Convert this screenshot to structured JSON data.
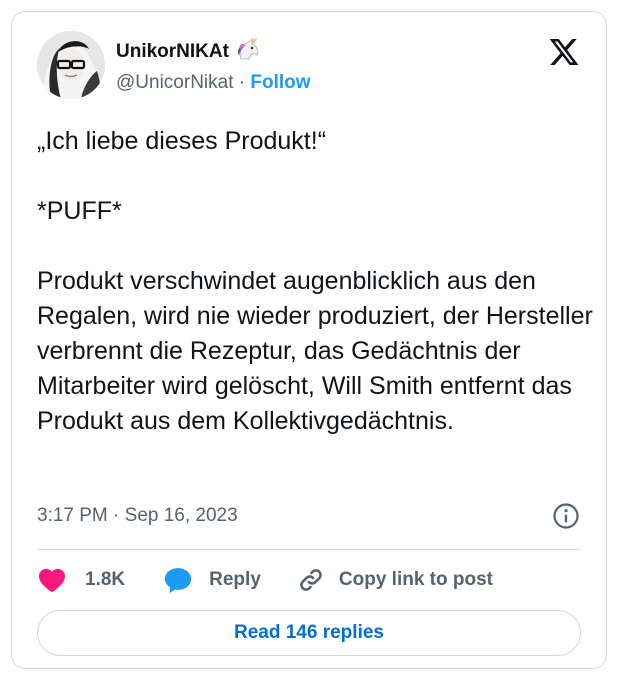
{
  "author": {
    "display_name": "UnikorNIKAt",
    "name_emoji_icon": "unicorn-icon",
    "handle": "@UnicorNikat",
    "separator": "·",
    "follow_label": "Follow"
  },
  "brand_icon": "x-logo-icon",
  "tweet": {
    "text": "„Ich liebe dieses Produkt!“\n\n*PUFF*\n\nProdukt verschwindet augenblicklich aus den Regalen, wird nie wieder produziert, der Hersteller verbrennt die Rezeptur, das Gedächtnis der Mitarbeiter wird gelöscht, Will Smith entfernt das Produkt aus dem Kollektivgedächtnis.",
    "timestamp": "3:17 PM · Sep 16, 2023"
  },
  "actions": {
    "likes": "1.8K",
    "reply_label": "Reply",
    "copy_link_label": "Copy link to post"
  },
  "read_replies_label": "Read 146 replies",
  "colors": {
    "link": "#1d9bf0",
    "like": "#f91880",
    "reply_icon": "#1d9bf0",
    "muted": "#536471",
    "border": "#cfd9de"
  }
}
